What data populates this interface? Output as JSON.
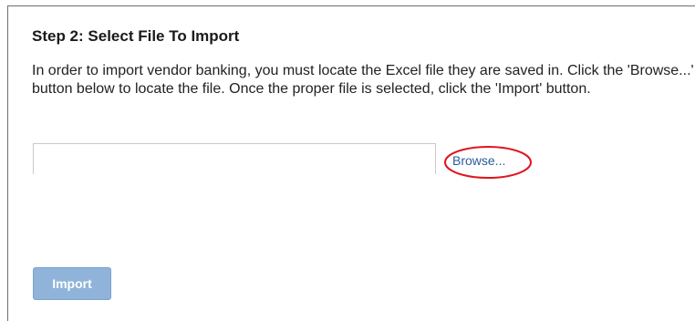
{
  "step": {
    "title": "Step 2: Select File To Import",
    "instructions": "In order to import vendor banking, you must locate the Excel file they are saved in. Click the 'Browse...' button below to locate the file. Once the proper file is selected, click the 'Import' button."
  },
  "file_input": {
    "value": "",
    "placeholder": ""
  },
  "browse_button": {
    "label": "Browse...",
    "highlight_color": "#e0141e"
  },
  "import_button": {
    "label": "Import",
    "state": "disabled"
  }
}
